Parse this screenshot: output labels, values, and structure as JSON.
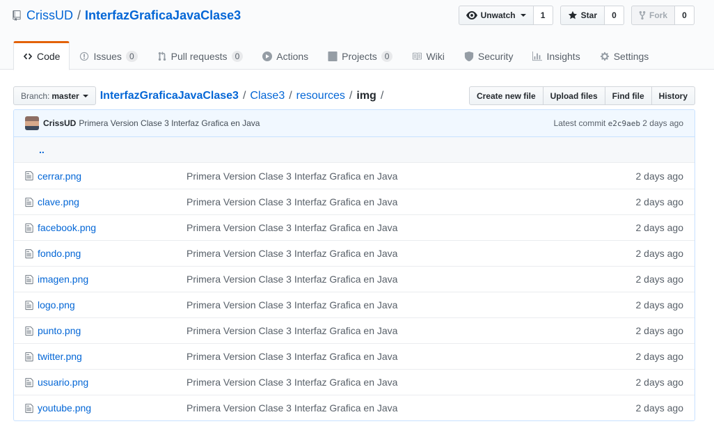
{
  "repo": {
    "owner": "CrissUD",
    "separator": "/",
    "name": "InterfazGraficaJavaClase3"
  },
  "actions": {
    "watch": {
      "label": "Unwatch",
      "count": "1",
      "icon": "eye-icon"
    },
    "star": {
      "label": "Star",
      "count": "0",
      "icon": "star-icon"
    },
    "fork": {
      "label": "Fork",
      "count": "0",
      "icon": "fork-icon"
    }
  },
  "nav": {
    "tabs": [
      {
        "label": "Code",
        "icon": "code-icon"
      },
      {
        "label": "Issues",
        "count": "0",
        "icon": "issue-icon"
      },
      {
        "label": "Pull requests",
        "count": "0",
        "icon": "pull-request-icon"
      },
      {
        "label": "Actions",
        "icon": "play-icon"
      },
      {
        "label": "Projects",
        "count": "0",
        "icon": "project-icon"
      },
      {
        "label": "Wiki",
        "icon": "book-icon"
      },
      {
        "label": "Security",
        "icon": "shield-icon"
      },
      {
        "label": "Insights",
        "icon": "graph-icon"
      },
      {
        "label": "Settings",
        "icon": "gear-icon"
      }
    ]
  },
  "filenav": {
    "branch_prefix": "Branch:",
    "branch": "master",
    "breadcrumb": [
      "InterfazGraficaJavaClase3",
      "Clase3",
      "resources",
      "img"
    ],
    "slash": "/",
    "buttons": [
      "Create new file",
      "Upload files",
      "Find file",
      "History"
    ]
  },
  "commit": {
    "author": "CrissUD",
    "message": "Primera Version Clase 3 Interfaz Grafica en Java",
    "latest_label": "Latest commit",
    "sha": "e2c9aeb",
    "age": "2 days ago"
  },
  "up_link": "..",
  "files": [
    {
      "name": "cerrar.png",
      "message": "Primera Version Clase 3 Interfaz Grafica en Java",
      "age": "2 days ago"
    },
    {
      "name": "clave.png",
      "message": "Primera Version Clase 3 Interfaz Grafica en Java",
      "age": "2 days ago"
    },
    {
      "name": "facebook.png",
      "message": "Primera Version Clase 3 Interfaz Grafica en Java",
      "age": "2 days ago"
    },
    {
      "name": "fondo.png",
      "message": "Primera Version Clase 3 Interfaz Grafica en Java",
      "age": "2 days ago"
    },
    {
      "name": "imagen.png",
      "message": "Primera Version Clase 3 Interfaz Grafica en Java",
      "age": "2 days ago"
    },
    {
      "name": "logo.png",
      "message": "Primera Version Clase 3 Interfaz Grafica en Java",
      "age": "2 days ago"
    },
    {
      "name": "punto.png",
      "message": "Primera Version Clase 3 Interfaz Grafica en Java",
      "age": "2 days ago"
    },
    {
      "name": "twitter.png",
      "message": "Primera Version Clase 3 Interfaz Grafica en Java",
      "age": "2 days ago"
    },
    {
      "name": "usuario.png",
      "message": "Primera Version Clase 3 Interfaz Grafica en Java",
      "age": "2 days ago"
    },
    {
      "name": "youtube.png",
      "message": "Primera Version Clase 3 Interfaz Grafica en Java",
      "age": "2 days ago"
    }
  ],
  "colors": {
    "link": "#0366d6",
    "tab_accent": "#e36209",
    "commit_bg": "#f1f8ff",
    "table_border": "#c8e1ff"
  }
}
